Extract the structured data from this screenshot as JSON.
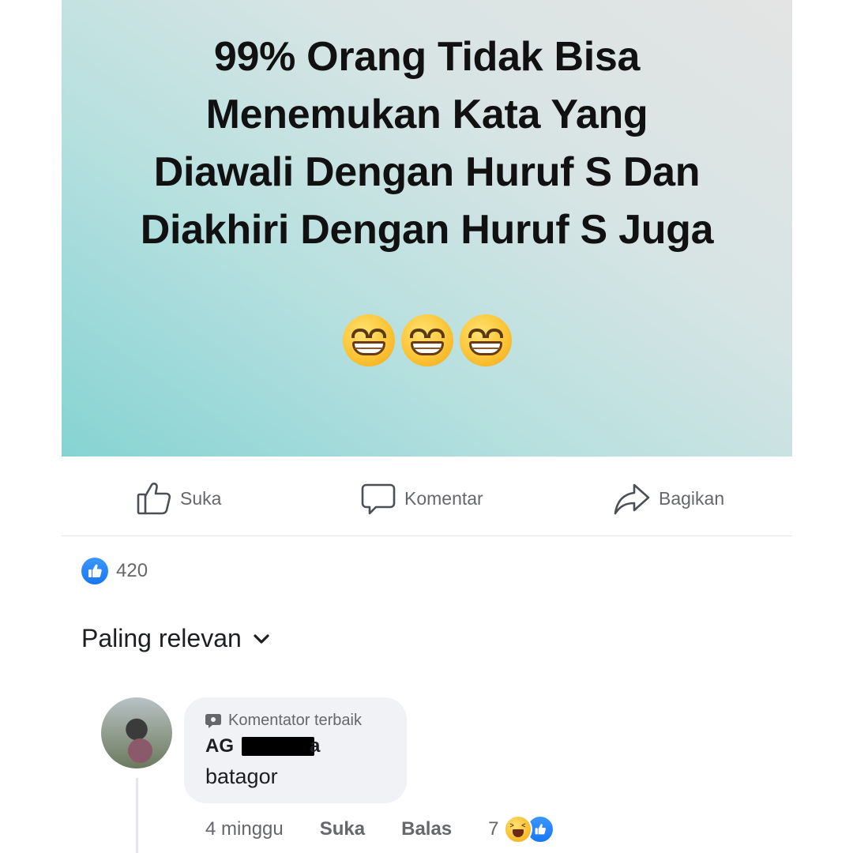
{
  "post": {
    "headline_lines": [
      "99% Orang Tidak Bisa",
      "Menemukan Kata Yang",
      "Diawali Dengan Huruf S Dan",
      "Diakhiri Dengan Huruf S Juga"
    ],
    "emoji": "grinning-face-with-smiling-eyes",
    "emoji_count": 3,
    "background_colors": [
      "#86d3d3",
      "#e4e4e4"
    ]
  },
  "actions": {
    "like_label": "Suka",
    "comment_label": "Komentar",
    "share_label": "Bagikan"
  },
  "reactions": {
    "icon": "like-icon",
    "count": "420"
  },
  "sort": {
    "label": "Paling relevan",
    "icon": "chevron-down-icon"
  },
  "comment": {
    "badge": "Komentator terbaik",
    "author_visible_prefix": "AG",
    "author_visible_suffix": "a",
    "text": "batagor",
    "time": "4 minggu",
    "like_label": "Suka",
    "reply_label": "Balas",
    "reaction_count": "7",
    "reaction_icons": [
      "haha-icon",
      "like-icon"
    ]
  },
  "colors": {
    "accent": "#1877f2",
    "secondary_text": "#65676b",
    "bubble": "#f0f2f5"
  }
}
